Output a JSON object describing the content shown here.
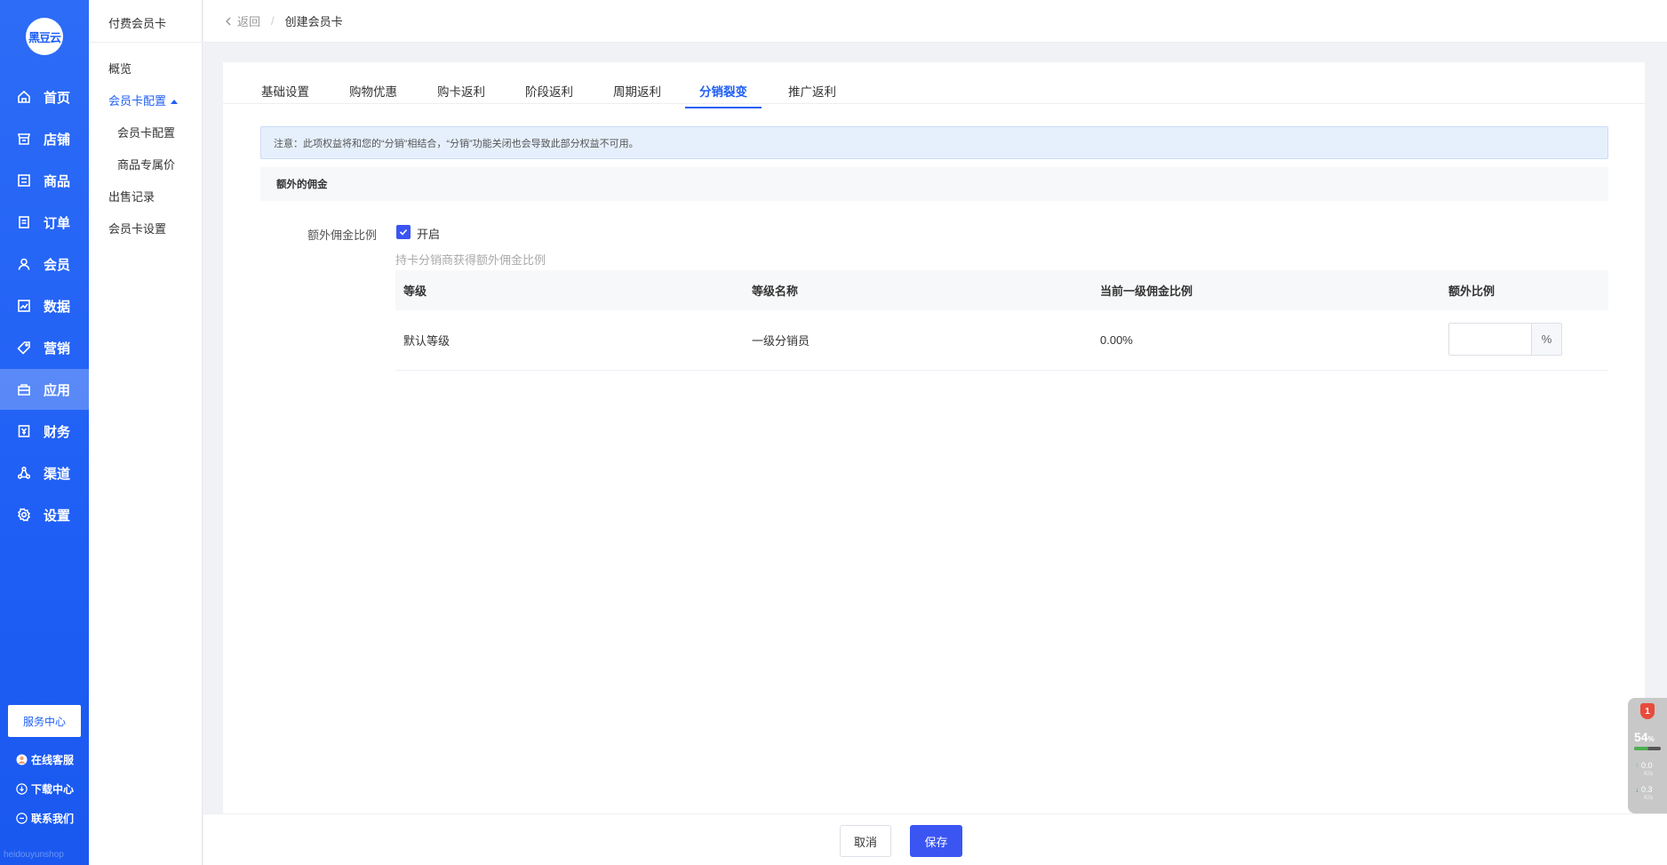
{
  "brand": {
    "logo_text": "黑豆云",
    "watermark": "heidouyunshop"
  },
  "nav": {
    "items": [
      {
        "label": "首页",
        "icon": "home-icon"
      },
      {
        "label": "店铺",
        "icon": "store-icon"
      },
      {
        "label": "商品",
        "icon": "goods-icon"
      },
      {
        "label": "订单",
        "icon": "order-icon"
      },
      {
        "label": "会员",
        "icon": "user-icon"
      },
      {
        "label": "数据",
        "icon": "chart-icon"
      },
      {
        "label": "营销",
        "icon": "tag-icon"
      },
      {
        "label": "应用",
        "icon": "app-icon"
      },
      {
        "label": "财务",
        "icon": "finance-icon"
      },
      {
        "label": "渠道",
        "icon": "channel-icon"
      },
      {
        "label": "设置",
        "icon": "gear-icon"
      }
    ],
    "active_index": 7,
    "service_button": "服务中心",
    "links": [
      {
        "label": "在线客服",
        "icon": "avatar-icon"
      },
      {
        "label": "下载中心",
        "icon": "download-icon"
      },
      {
        "label": "联系我们",
        "icon": "message-icon"
      }
    ]
  },
  "subnav": {
    "title": "付费会员卡",
    "items": [
      "概览",
      "会员卡配置",
      "会员卡配置",
      "商品专属价",
      "出售记录",
      "会员卡设置"
    ]
  },
  "breadcrumb": {
    "back": "返回",
    "separator": "/",
    "current": "创建会员卡"
  },
  "tabs": [
    "基础设置",
    "购物优惠",
    "购卡返利",
    "阶段返利",
    "周期返利",
    "分销裂变",
    "推广返利"
  ],
  "active_tab": "分销裂变",
  "notice": "注意：此项权益将和您的“分销”相结合，“分销”功能关闭也会导致此部分权益不可用。",
  "section_title": "额外的佣金",
  "form": {
    "label": "额外佣金比例",
    "checkbox_label": "开启",
    "checked": true,
    "hint": "持卡分销商获得额外佣金比例"
  },
  "table": {
    "headers": [
      "等级",
      "等级名称",
      "当前一级佣金比例",
      "额外比例"
    ],
    "rows": [
      {
        "level": "默认等级",
        "name": "一级分销员",
        "current_ratio": "0.00%",
        "extra_value": "",
        "suffix": "%"
      }
    ]
  },
  "footer": {
    "cancel": "取消",
    "save": "保存"
  },
  "widget": {
    "badge": "1",
    "percent": "54",
    "percent_unit": "%",
    "up": "0.0",
    "down": "0.3",
    "unit": "K/s"
  },
  "colors": {
    "primary": "#1f5ff5",
    "accent": "#3a55f2"
  }
}
